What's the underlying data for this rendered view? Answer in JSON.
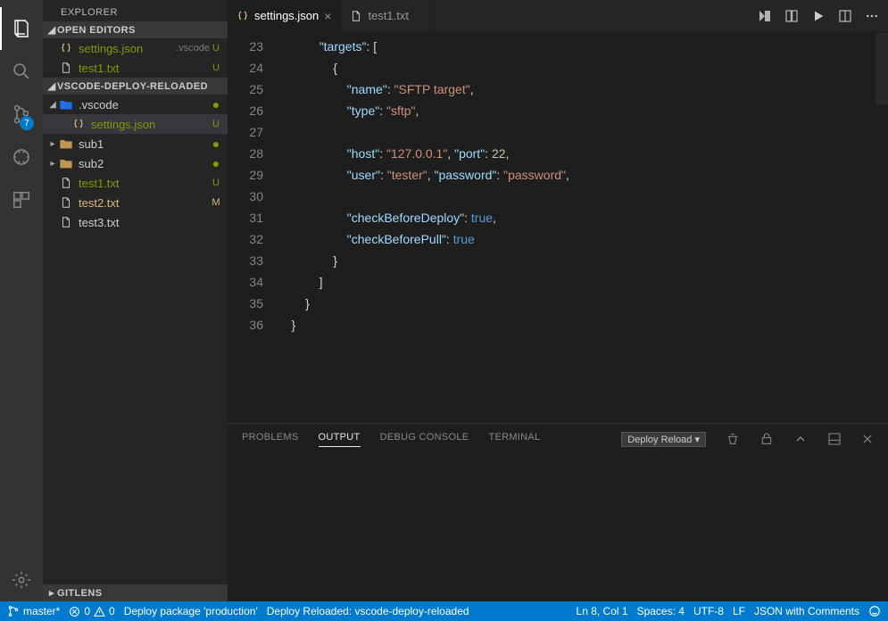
{
  "activityBar": {
    "scmBadge": "7"
  },
  "sidebar": {
    "title": "EXPLORER",
    "sections": {
      "openEditors": {
        "label": "OPEN EDITORS",
        "items": [
          {
            "name": "settings.json",
            "hint": ".vscode",
            "status": "U"
          },
          {
            "name": "test1.txt",
            "status": "U"
          }
        ]
      },
      "workspace": {
        "label": "VSCODE-DEPLOY-RELOADED",
        "tree": {
          "vscode": {
            "name": ".vscode",
            "settings": "settings.json"
          },
          "sub1": "sub1",
          "sub2": "sub2",
          "test1": {
            "name": "test1.txt",
            "status": "U"
          },
          "test2": {
            "name": "test2.txt",
            "status": "M"
          },
          "test3": {
            "name": "test3.txt"
          }
        }
      },
      "gitlens": {
        "label": "GITLENS"
      }
    }
  },
  "tabs": [
    {
      "name": "settings.json",
      "icon": "braces",
      "active": true
    },
    {
      "name": "test1.txt",
      "icon": "file",
      "active": false
    }
  ],
  "editor": {
    "startLine": 23,
    "lines": [
      [
        [
          "            ",
          ""
        ],
        [
          "\"targets\"",
          "key"
        ],
        [
          ": [",
          "punct"
        ]
      ],
      [
        [
          "                {",
          "punct"
        ]
      ],
      [
        [
          "                    ",
          ""
        ],
        [
          "\"name\"",
          "key"
        ],
        [
          ": ",
          "punct"
        ],
        [
          "\"SFTP target\"",
          "str"
        ],
        [
          ",",
          "punct"
        ]
      ],
      [
        [
          "                    ",
          ""
        ],
        [
          "\"type\"",
          "key"
        ],
        [
          ": ",
          "punct"
        ],
        [
          "\"sftp\"",
          "str"
        ],
        [
          ",",
          "punct"
        ]
      ],
      [],
      [
        [
          "                    ",
          ""
        ],
        [
          "\"host\"",
          "key"
        ],
        [
          ": ",
          "punct"
        ],
        [
          "\"127.0.0.1\"",
          "str"
        ],
        [
          ", ",
          "punct"
        ],
        [
          "\"port\"",
          "key"
        ],
        [
          ": ",
          "punct"
        ],
        [
          "22",
          "num"
        ],
        [
          ",",
          "punct"
        ]
      ],
      [
        [
          "                    ",
          ""
        ],
        [
          "\"user\"",
          "key"
        ],
        [
          ": ",
          "punct"
        ],
        [
          "\"tester\"",
          "str"
        ],
        [
          ", ",
          "punct"
        ],
        [
          "\"password\"",
          "key"
        ],
        [
          ": ",
          "punct"
        ],
        [
          "\"password\"",
          "str"
        ],
        [
          ",",
          "punct"
        ]
      ],
      [],
      [
        [
          "                    ",
          ""
        ],
        [
          "\"checkBeforeDeploy\"",
          "key"
        ],
        [
          ": ",
          "punct"
        ],
        [
          "true",
          "bool"
        ],
        [
          ",",
          "punct"
        ]
      ],
      [
        [
          "                    ",
          ""
        ],
        [
          "\"checkBeforePull\"",
          "key"
        ],
        [
          ": ",
          "punct"
        ],
        [
          "true",
          "bool"
        ]
      ],
      [
        [
          "                }",
          "punct"
        ]
      ],
      [
        [
          "            ]",
          "punct"
        ]
      ],
      [
        [
          "        }",
          "punct"
        ]
      ],
      [
        [
          "    }",
          "punct"
        ]
      ]
    ]
  },
  "panel": {
    "tabs": {
      "problems": "PROBLEMS",
      "output": "OUTPUT",
      "debug": "DEBUG CONSOLE",
      "terminal": "TERMINAL"
    },
    "dropdown": "Deploy Reload"
  },
  "statusBar": {
    "branch": "master*",
    "errors": "0",
    "warnings": "0",
    "deploy1": "Deploy package 'production'",
    "deploy2": "Deploy Reloaded: vscode-deploy-reloaded",
    "cursor": "Ln 8, Col 1",
    "spaces": "Spaces: 4",
    "encoding": "UTF-8",
    "eol": "LF",
    "lang": "JSON with Comments"
  }
}
